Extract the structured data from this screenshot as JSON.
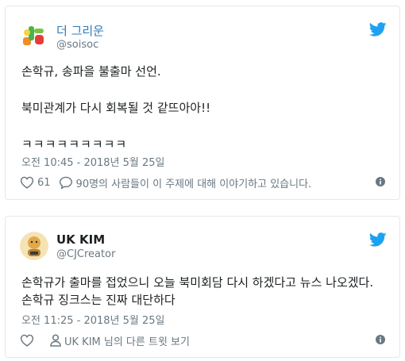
{
  "tweets": [
    {
      "name": "더 그리운",
      "handle": "@soisoc",
      "lines": [
        "손학규, 송파을 불출마 선언.",
        "북미관계가 다시 회복될 것 같뜨아아!!",
        "ㅋㅋㅋㅋㅋㅋㅋㅋㅋ"
      ],
      "timestamp": "오전 10:45 - 2018년 5월 25일",
      "likes": "61",
      "replies_label": "90명의 사람들이 이 주제에 대해 이야기하고 있습니다."
    },
    {
      "name": "UK KIM",
      "handle": "@CJCreator",
      "lines": [
        "손학규가 출마를 접었으니 오늘 북미회담 다시 하겠다고 뉴스 나오겠다. 손학규 징크스는 진짜 대단하다"
      ],
      "timestamp": "오전 11:25 - 2018년 5월 25일",
      "more_label": "UK KIM 님의 다른 트윗 보기"
    }
  ],
  "colors": {
    "twitter_blue": "#1da1f2",
    "link_blue": "#2b7bb9",
    "meta_gray": "#697882"
  },
  "icons": [
    "twitter-bird-icon",
    "heart-icon",
    "reply-bubble-icon",
    "person-icon",
    "info-icon"
  ]
}
